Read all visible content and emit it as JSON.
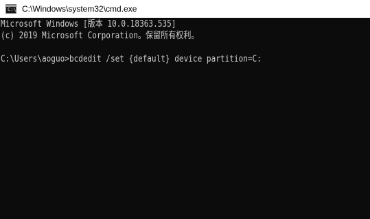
{
  "window": {
    "title": "C:\\Windows\\system32\\cmd.exe",
    "icon": "cmd-icon"
  },
  "console": {
    "lines": [
      "Microsoft Windows [版本 10.0.18363.535]",
      "(c) 2019 Microsoft Corporation。保留所有权利。",
      "",
      "C:\\Users\\aoguo>bcdedit /set {default} device partition=C:"
    ]
  },
  "colors": {
    "console_background": "#0c0c0c",
    "console_text": "#cccccc",
    "titlebar_background": "#ffffff"
  }
}
